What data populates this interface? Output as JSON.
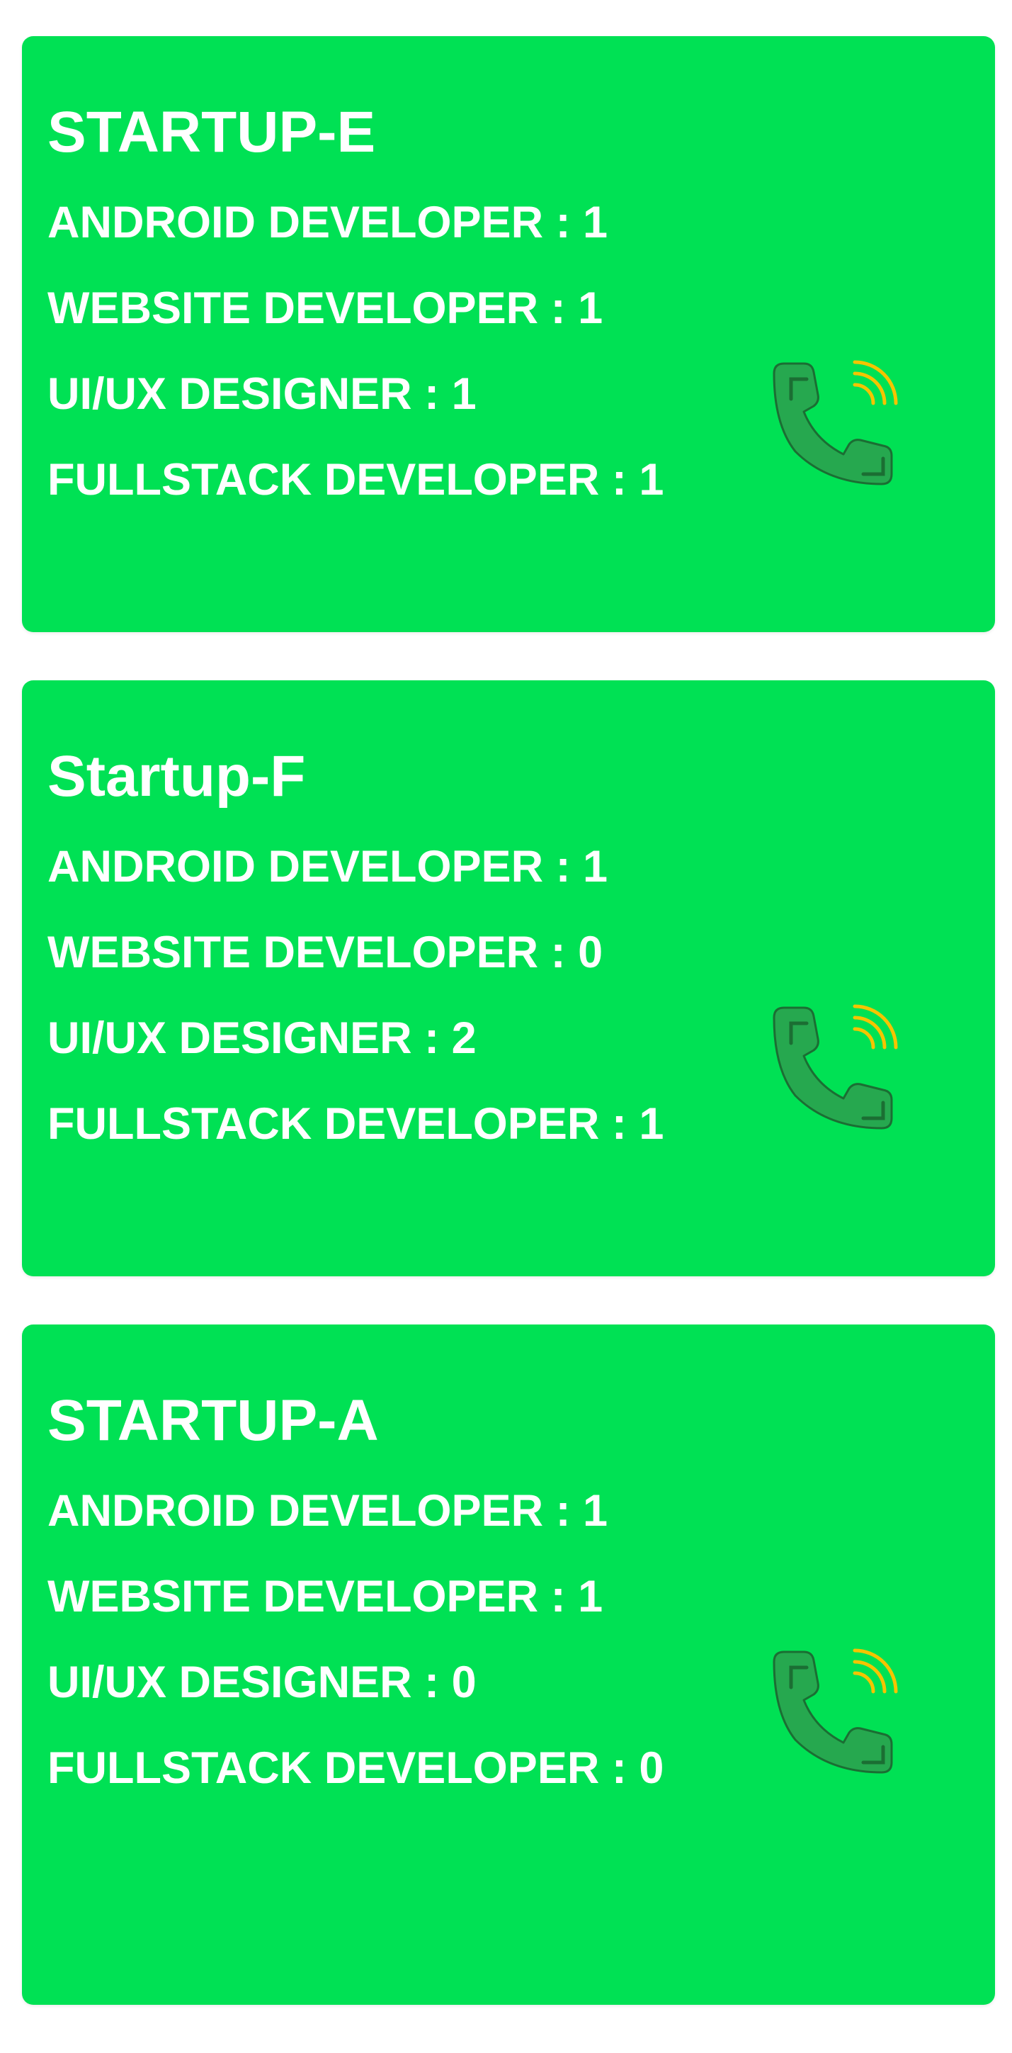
{
  "colors": {
    "card_background": "#00e154",
    "text": "#ffffff",
    "phone_icon": "#26a84f",
    "phone_icon_outline": "#1b6e33",
    "signal_waves": "#f5c400"
  },
  "icons": {
    "call": "phone-call-icon"
  },
  "startups": [
    {
      "name": "STARTUP-E",
      "roles": [
        "ANDROID DEVELOPER : 1",
        "WEBSITE DEVELOPER : 1",
        "UI/UX DESIGNER : 1",
        "FULLSTACK DEVELOPER : 1"
      ]
    },
    {
      "name": "Startup-F",
      "roles": [
        "ANDROID DEVELOPER : 1",
        "WEBSITE DEVELOPER : 0",
        "UI/UX DESIGNER : 2",
        "FULLSTACK DEVELOPER : 1"
      ]
    },
    {
      "name": "STARTUP-A",
      "roles": [
        "ANDROID DEVELOPER : 1",
        "WEBSITE DEVELOPER : 1",
        "UI/UX DESIGNER : 0",
        "FULLSTACK DEVELOPER : 0"
      ]
    }
  ]
}
